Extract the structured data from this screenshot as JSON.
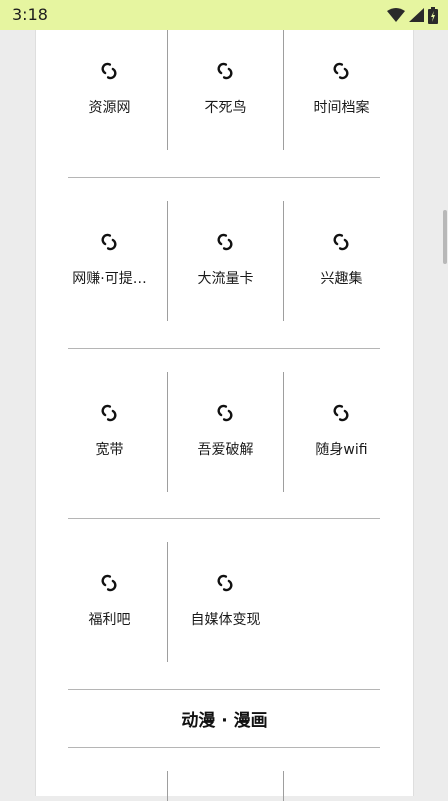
{
  "status_bar": {
    "time": "3:18",
    "icons": [
      "wifi-icon",
      "cell-signal-icon",
      "battery-icon"
    ]
  },
  "grid_rows": [
    {
      "cells": [
        {
          "label": "资源网",
          "icon": "link-icon"
        },
        {
          "label": "不死鸟",
          "icon": "link-icon"
        },
        {
          "label": "时间档案",
          "icon": "link-icon"
        }
      ]
    },
    {
      "cells": [
        {
          "label": "网赚·可提…",
          "icon": "link-icon"
        },
        {
          "label": "大流量卡",
          "icon": "link-icon"
        },
        {
          "label": "兴趣集",
          "icon": "link-icon"
        }
      ]
    },
    {
      "cells": [
        {
          "label": "宽带",
          "icon": "link-icon"
        },
        {
          "label": "吾爱破解",
          "icon": "link-icon"
        },
        {
          "label": "随身wifi",
          "icon": "link-icon"
        }
      ]
    },
    {
      "cells": [
        {
          "label": "福利吧",
          "icon": "link-icon"
        },
        {
          "label": "自媒体变现",
          "icon": "link-icon"
        }
      ]
    }
  ],
  "section": {
    "title": "动漫 · 漫画"
  },
  "colors": {
    "status_bar_bg": "#e6f5a0",
    "page_bg": "#ececec",
    "card_bg": "#ffffff"
  }
}
